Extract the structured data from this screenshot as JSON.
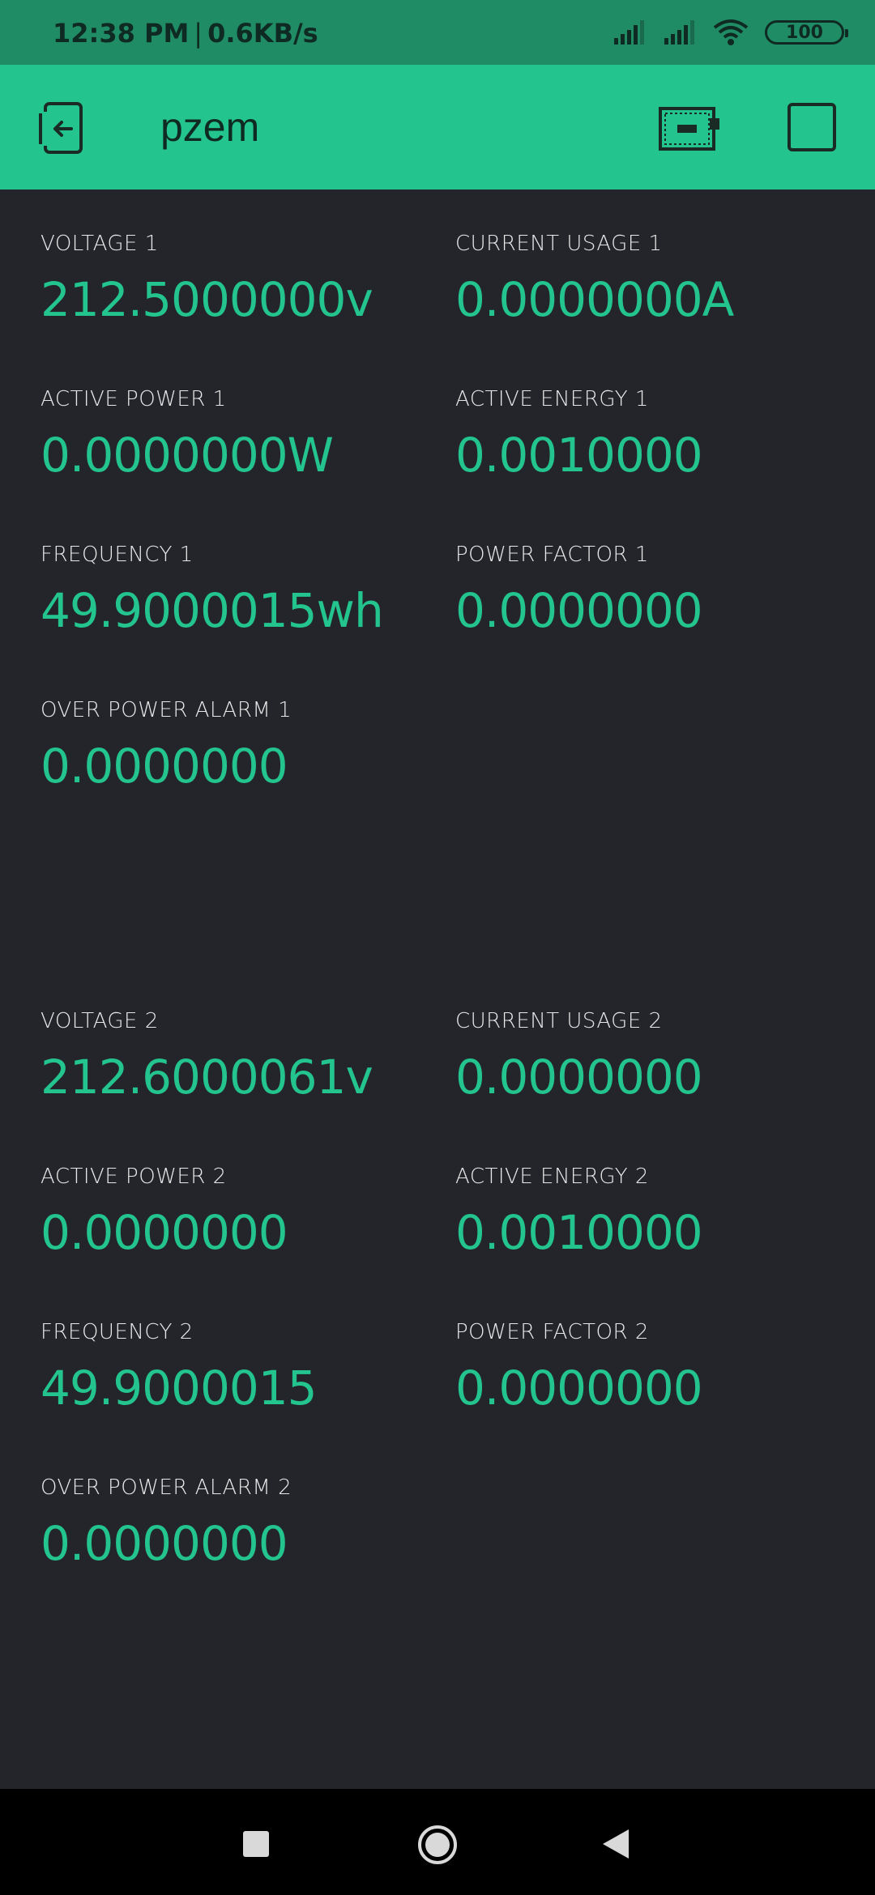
{
  "status_bar": {
    "time": "12:38 PM",
    "separator": "|",
    "network_speed": "0.6KB/s",
    "battery": "100",
    "icons": [
      "signal-icon",
      "signal-icon",
      "wifi-icon",
      "battery-icon"
    ]
  },
  "header": {
    "title": "pzem",
    "back_icon": "exit-icon",
    "device_icon": "device-icon",
    "stop_icon": "stop-icon"
  },
  "widgets": [
    {
      "label": "VOLTAGE 1",
      "value": "212.5000000v"
    },
    {
      "label": "CURRENT USAGE 1",
      "value": "0.0000000A"
    },
    {
      "label": "ACTIVE POWER 1",
      "value": "0.0000000W"
    },
    {
      "label": "ACTIVE ENERGY 1",
      "value": "0.0010000"
    },
    {
      "label": "FREQUENCY 1",
      "value": "49.9000015wh"
    },
    {
      "label": "POWER FACTOR 1",
      "value": "0.0000000"
    },
    {
      "label": "OVER POWER ALARM 1",
      "value": "0.0000000"
    },
    {
      "label": "VOLTAGE 2",
      "value": "212.6000061v"
    },
    {
      "label": "CURRENT USAGE 2",
      "value": "0.0000000"
    },
    {
      "label": "ACTIVE POWER 2",
      "value": "0.0000000"
    },
    {
      "label": "ACTIVE ENERGY 2",
      "value": "0.0010000"
    },
    {
      "label": "FREQUENCY 2",
      "value": "49.9000015"
    },
    {
      "label": "POWER FACTOR 2",
      "value": "0.0000000"
    },
    {
      "label": "OVER POWER ALARM 2",
      "value": "0.0000000"
    }
  ],
  "colors": {
    "status_bar": "#1f8c66",
    "header": "#23c48e",
    "background": "#23252b",
    "value_text": "#23c48e",
    "label_text": "#e8e8e8",
    "nav_bar": "#000000"
  },
  "nav": {
    "icons": [
      "recent-apps-icon",
      "home-icon",
      "back-icon"
    ]
  }
}
